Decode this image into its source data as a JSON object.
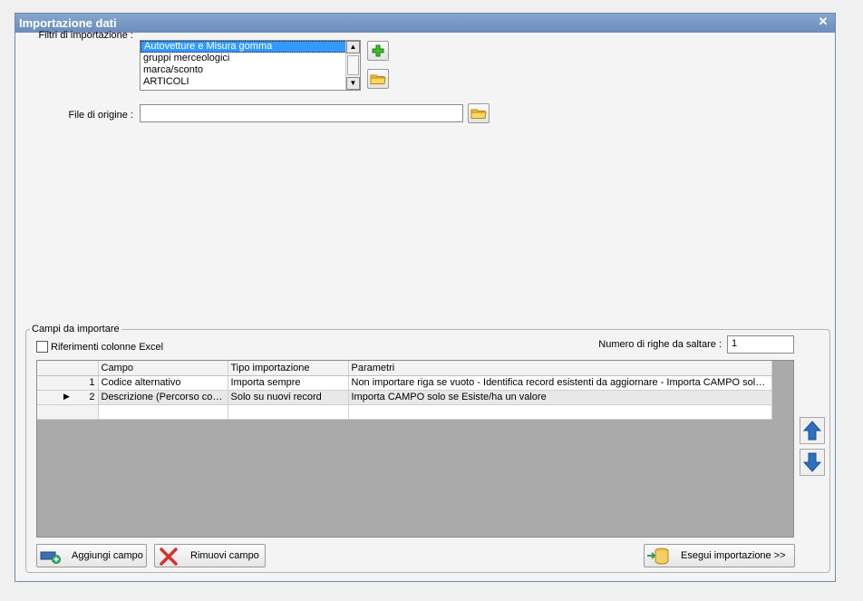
{
  "window": {
    "title": "Importazione dati"
  },
  "filters": {
    "label": "Filtri di importazione :",
    "items": [
      "Autovetture e Misura gomma",
      "gruppi merceologici",
      "marca/sconto",
      "ARTICOLI"
    ],
    "selected_index": 0
  },
  "source_file": {
    "label": "File di origine :",
    "value": ""
  },
  "fields_group": {
    "legend": "Campi da importare",
    "excel_refs_label": "Riferimenti colonne Excel",
    "excel_refs_checked": false,
    "skip_rows_label": "Numero di righe da saltare :",
    "skip_rows_value": "1"
  },
  "grid": {
    "columns": [
      "Campo",
      "Tipo importazione",
      "Parametri"
    ],
    "rows": [
      {
        "num": "1",
        "campo": "Codice alternativo",
        "tipo": "Importa sempre",
        "parametri": "Non importare riga se vuoto - Identifica record esistenti da aggiornare - Importa CAMPO solo ..."
      },
      {
        "num": "2",
        "campo": "Descrizione (Percorso com...",
        "tipo": "Solo su nuovi record",
        "parametri": "Importa CAMPO solo se Esiste/ha un valore"
      }
    ],
    "current_row_marker": "▶"
  },
  "buttons": {
    "add_field": "Aggiungi campo",
    "remove_field": "Rimuovi campo",
    "run_import": "Esegui importazione >>"
  },
  "colors": {
    "title_bar": "#7a9bc6",
    "grid_bg": "#aaaaaa",
    "selection": "#3399ff",
    "arrow_blue": "#2f6fc0"
  }
}
